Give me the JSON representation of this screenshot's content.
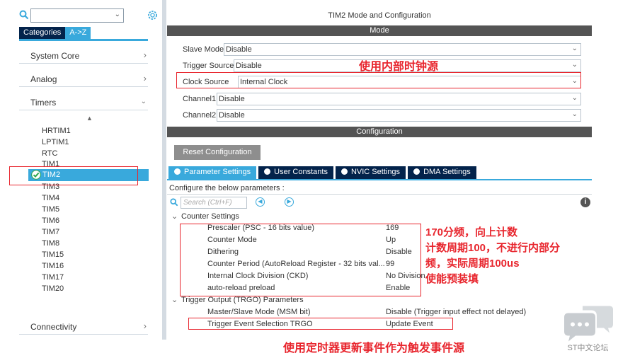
{
  "left_panel": {
    "tabs": [
      "Categories",
      "A->Z"
    ],
    "categories": [
      {
        "label": "System Core",
        "arrow": ">"
      },
      {
        "label": "Analog",
        "arrow": ">"
      },
      {
        "label": "Timers",
        "arrow": "v"
      }
    ],
    "timers": [
      "HRTIM1",
      "LPTIM1",
      "RTC",
      "TIM1",
      "TIM2",
      "TIM3",
      "TIM4",
      "TIM5",
      "TIM6",
      "TIM7",
      "TIM8",
      "TIM15",
      "TIM16",
      "TIM17",
      "TIM20"
    ],
    "selected_timer": "TIM2",
    "connectivity": {
      "label": "Connectivity",
      "arrow": ">"
    }
  },
  "right_panel": {
    "title": "TIM2 Mode and Configuration",
    "mode_header": "Mode",
    "mode_rows": [
      {
        "label": "Slave Mode",
        "value": "Disable"
      },
      {
        "label": "Trigger Source",
        "value": "Disable"
      },
      {
        "label": "Clock Source",
        "value": "Internal Clock"
      },
      {
        "label": "Channel1",
        "value": "Disable"
      },
      {
        "label": "Channel2",
        "value": "Disable"
      }
    ],
    "config_header": "Configuration",
    "reset_button": "Reset Configuration",
    "param_tabs": [
      "Parameter Settings",
      "User Constants",
      "NVIC Settings",
      "DMA Settings"
    ],
    "configure_text": "Configure the below parameters :",
    "search_placeholder": "Search (Ctrl+F)",
    "groups": [
      {
        "title": "Counter Settings",
        "params": [
          {
            "name": "Prescaler (PSC - 16 bits value)",
            "value": "169"
          },
          {
            "name": "Counter Mode",
            "value": "Up"
          },
          {
            "name": "Dithering",
            "value": "Disable"
          },
          {
            "name": "Counter Period (AutoReload Register - 32 bits val...",
            "value": "99"
          },
          {
            "name": "Internal Clock Division (CKD)",
            "value": "No Division"
          },
          {
            "name": "auto-reload preload",
            "value": "Enable"
          }
        ]
      },
      {
        "title": "Trigger Output (TRGO) Parameters",
        "params": [
          {
            "name": "Master/Slave Mode (MSM bit)",
            "value": "Disable (Trigger input effect not delayed)"
          },
          {
            "name": "Trigger Event Selection TRGO",
            "value": "Update Event"
          }
        ]
      }
    ]
  },
  "annotations": {
    "clock_note": "使用内部时钟源",
    "counter_note_lines": [
      "170分频，向上计数",
      "计数周期100，不进行内部分",
      "频，实际周期100us",
      "使能预装填"
    ],
    "trgo_note": "使用定时器更新事件作为触发事件源"
  },
  "watermark": "ST中文论坛",
  "colors": {
    "dark_navy": "#03234b",
    "accent_blue": "#39a9dc",
    "band_gray": "#545454",
    "annotation_red": "#e8262e"
  }
}
